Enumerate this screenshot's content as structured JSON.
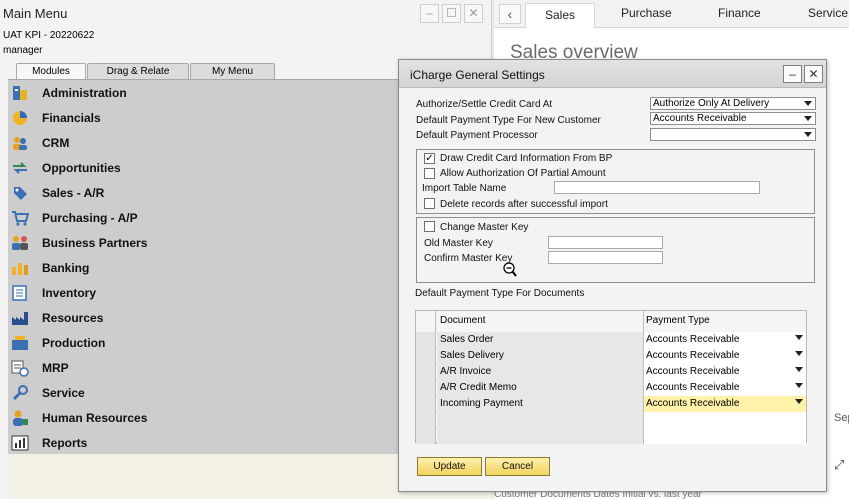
{
  "main_menu": {
    "title": "Main Menu",
    "company": "UAT KPI - 20220622",
    "user": "manager",
    "window_buttons": [
      "minimize",
      "maximize",
      "close"
    ],
    "tabs": [
      {
        "label": "Modules",
        "active": true
      },
      {
        "label": "Drag & Relate",
        "active": false
      },
      {
        "label": "My Menu",
        "active": false
      }
    ],
    "modules": [
      {
        "label": "Administration",
        "icon": "administration-icon"
      },
      {
        "label": "Financials",
        "icon": "financials-icon"
      },
      {
        "label": "CRM",
        "icon": "crm-icon"
      },
      {
        "label": "Opportunities",
        "icon": "opportunities-icon"
      },
      {
        "label": "Sales - A/R",
        "icon": "sales-icon"
      },
      {
        "label": "Purchasing - A/P",
        "icon": "purchasing-icon"
      },
      {
        "label": "Business Partners",
        "icon": "business-partners-icon"
      },
      {
        "label": "Banking",
        "icon": "banking-icon"
      },
      {
        "label": "Inventory",
        "icon": "inventory-icon"
      },
      {
        "label": "Resources",
        "icon": "resources-icon"
      },
      {
        "label": "Production",
        "icon": "production-icon"
      },
      {
        "label": "MRP",
        "icon": "mrp-icon"
      },
      {
        "label": "Service",
        "icon": "service-icon"
      },
      {
        "label": "Human Resources",
        "icon": "human-resources-icon"
      },
      {
        "label": "Reports",
        "icon": "reports-icon"
      }
    ]
  },
  "cockpit": {
    "back_arrow": "‹",
    "tabs": [
      "Sales",
      "Purchase",
      "Finance",
      "Service"
    ],
    "active_tab": "Sales",
    "title": "Sales overview",
    "side_text": "Sep",
    "expand_icon": "⤢",
    "footer_text": "Customer            Documents Dates        Initial          vs. last year"
  },
  "dialog": {
    "title": "iCharge General Settings",
    "fields": {
      "authorize_label": "Authorize/Settle Credit Card At",
      "authorize_value": "Authorize Only At Delivery",
      "payment_type_label": "Default Payment Type For New Customer",
      "payment_type_value": "Accounts Receivable",
      "processor_label": "Default Payment Processor",
      "processor_value": ""
    },
    "group1": {
      "draw_cc_label": "Draw Credit Card Information From BP",
      "draw_cc_checked": true,
      "allow_partial_label": "Allow Authorization Of Partial Amount",
      "allow_partial_checked": false,
      "import_table_label": "Import Table Name",
      "import_table_value": "",
      "delete_records_label": "Delete records after successful import",
      "delete_records_checked": false
    },
    "group2": {
      "change_key_label": "Change Master Key",
      "change_key_checked": false,
      "old_key_label": "Old Master Key",
      "confirm_key_label": "Confirm Master Key"
    },
    "documents_section_label": "Default Payment Type For Documents",
    "grid": {
      "columns": [
        "Document",
        "Payment Type"
      ],
      "rows": [
        {
          "document": "Sales Order",
          "payment_type": "Accounts Receivable"
        },
        {
          "document": "Sales Delivery",
          "payment_type": "Accounts Receivable"
        },
        {
          "document": "A/R Invoice",
          "payment_type": "Accounts Receivable"
        },
        {
          "document": "A/R Credit Memo",
          "payment_type": "Accounts Receivable"
        },
        {
          "document": "Incoming Payment",
          "payment_type": "Accounts Receivable",
          "selected": true
        }
      ]
    },
    "buttons": {
      "update": "Update",
      "cancel": "Cancel"
    }
  },
  "colors": {
    "button_gold": "#f2d35e",
    "selected_cell": "#fff3a9",
    "module_panel": "#cdcdcd"
  }
}
